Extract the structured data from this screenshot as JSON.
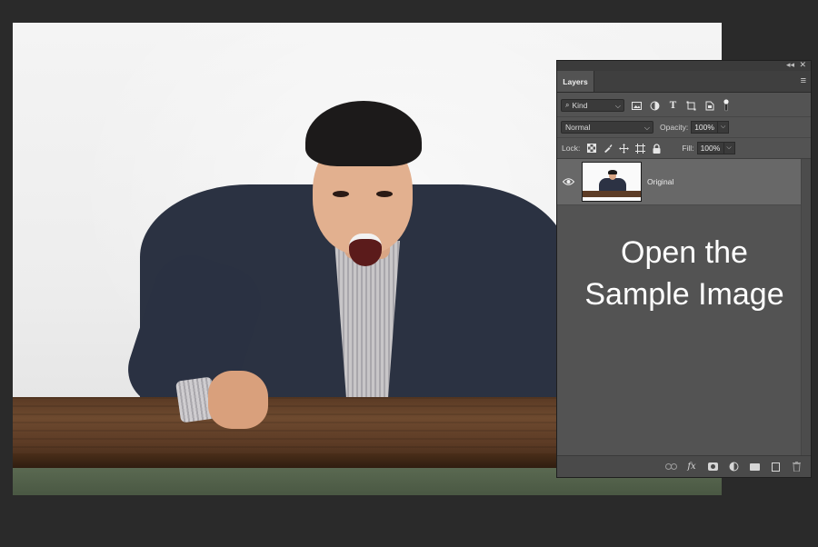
{
  "photo": {
    "subject": "angry man in suit leaning on wooden table"
  },
  "panel": {
    "tab_label": "Layers",
    "collapse_glyph": "◂◂",
    "close_glyph": "✕",
    "menu_glyph": "≡",
    "filter": {
      "label": "Kind",
      "icons": [
        "pixel-filter-icon",
        "adjustment-filter-icon",
        "type-filter-icon",
        "shape-filter-icon",
        "smart-object-filter-icon",
        "filter-toggle-icon"
      ]
    },
    "blend": {
      "mode": "Normal",
      "opacity_label": "Opacity:",
      "opacity_value": "100%"
    },
    "lock": {
      "label": "Lock:",
      "fill_label": "Fill:",
      "fill_value": "100%"
    },
    "layers": [
      {
        "name": "Original",
        "visible": true
      }
    ],
    "overlay_text_line1": "Open the",
    "overlay_text_line2": "Sample Image",
    "bottom_icons": [
      "link-layers-icon",
      "fx-icon",
      "layer-mask-icon",
      "adjustment-layer-icon",
      "group-folder-icon",
      "new-layer-icon",
      "delete-layer-icon"
    ]
  },
  "colors": {
    "panel_bg": "#535353",
    "selected_layer_bg": "#686868",
    "canvas_bg": "#2a2a2a"
  }
}
